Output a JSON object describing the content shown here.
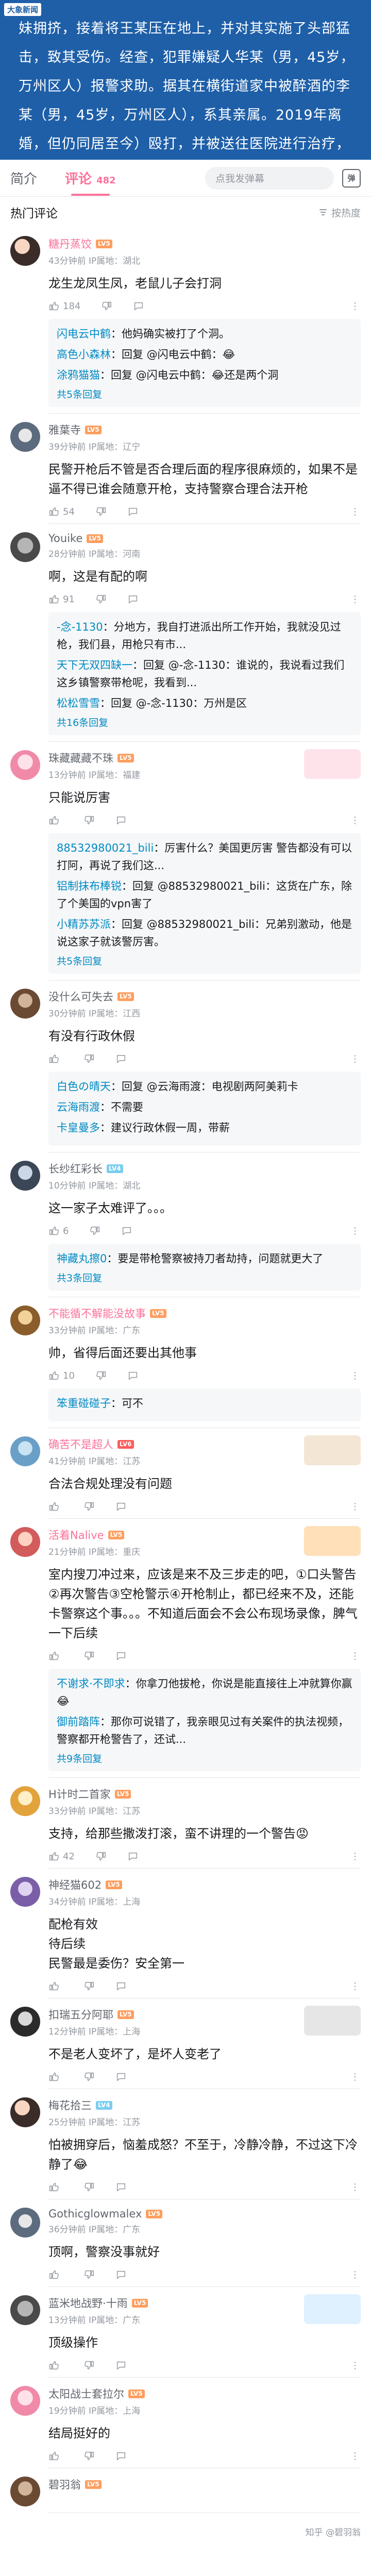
{
  "banner": {
    "badge": "大象新闻",
    "text": "妹拥挤，接着将王某压在地上，并对其实施了头部猛击，致其受伤。经查，犯罪嫌疑人华某（男，45岁，万州区人）报警求助。据其在横街道家中被醉酒的李某（男，45岁，万州区人），系其亲属。2019年离婚，但仍同居至今）殴打，并被送往医院进行治疗，经医院诊断为轻微伤。民警迅速出警，当事人将其带至派出所接受调查。调解中李某被警方依法行政拘留处罚。"
  },
  "tabs": {
    "intro": "简介",
    "comments": "评论",
    "comment_count": "482",
    "danmu_placeholder": "点我发弹幕",
    "danmu_icon": "弹"
  },
  "section": {
    "title": "热门评论",
    "sort_label": "按热度"
  },
  "comments": [
    {
      "name": "糖丹蒸饺",
      "level": "LV5",
      "time": "43分钟前",
      "location": "IP属地：湖北",
      "text": "龙生龙凤生凤，老鼠儿子会打洞",
      "likes": "184",
      "replies": [
        {
          "name": "闪电云中鹤",
          "text": "：他妈确实被打了个洞。"
        },
        {
          "name": "高色小森林",
          "text": "：回复 @闪电云中鹤：😂"
        },
        {
          "name": "涂鸦猫猫",
          "text": "：回复 @闪电云中鹤：😂还是两个洞"
        }
      ],
      "reply_total": "共5条回复"
    },
    {
      "name": "雅葉寺",
      "level": "LV5",
      "time": "39分钟前",
      "location": "IP属地：辽宁",
      "text": "民警开枪后不管是否合理后面的程序很麻烦的，如果不是逼不得已谁会随意开枪，支持警察合理合法开枪",
      "likes": "54",
      "replies": [],
      "reply_total": ""
    },
    {
      "name": "Youike",
      "level": "LV5",
      "time": "28分钟前",
      "location": "IP属地：河南",
      "text": "啊，这是有配的啊",
      "likes": "91",
      "replies": [
        {
          "name": "-念-1130",
          "text": "：分地方，我自打进派出所工作开始，我就没见过枪，我们县，用枪只有市..."
        },
        {
          "name": "天下无双四缺一",
          "text": "：回复 @-念-1130：谁说的，我说看过我们这乡镇警察带枪呢，我看到..."
        },
        {
          "name": "松松雪雪",
          "text": "：回复 @-念-1130：万州是区"
        }
      ],
      "reply_total": "共16条回复"
    },
    {
      "name": "珠藏藏藏不珠",
      "level": "LV5",
      "time": "13分钟前",
      "location": "IP属地：福建",
      "text": "只能说厉害",
      "likes": "",
      "replies": [
        {
          "name": "88532980021_bili",
          "text": "：厉害什么？美国更厉害 警告都没有可以打阿，再说了我们这..."
        },
        {
          "name": "铝制抹布棒锐",
          "text": "：回复 @88532980021_bili：这货在广东，除了个美国的vpn害了"
        },
        {
          "name": "小精苏苏派",
          "text": "：回复 @88532980021_bili：兄弟别激动，他是说这家子就该警厉害。"
        }
      ],
      "reply_total": "共5条回复"
    },
    {
      "name": "没什么可失去",
      "level": "LV5",
      "time": "30分钟前",
      "location": "IP属地：江西",
      "text": "有没有行政休假",
      "likes": "",
      "replies": [
        {
          "name": "白色の晴天",
          "text": "：回复 @云海雨渡：电视剧两阿美莉卡"
        },
        {
          "name": "云海雨渡",
          "text": "：不需要"
        },
        {
          "name": "卡皇曼多",
          "text": "：建议行政休假一周，带薪"
        }
      ],
      "reply_total": ""
    },
    {
      "name": "长纱红彩长",
      "level": "LV4",
      "time": "10分钟前",
      "location": "IP属地：湖北",
      "text": "这一家子太难评了。。。",
      "likes": "6",
      "replies": [
        {
          "name": "神藏丸擦0",
          "text": "：要是带枪警察被持刀者劫持，问题就更大了"
        }
      ],
      "reply_total": "共3条回复"
    },
    {
      "name": "不能循不解能没故事",
      "level": "LV5",
      "time": "33分钟前",
      "location": "IP属地：广东",
      "text": "帅，省得后面还要出其他事",
      "likes": "10",
      "replies": [
        {
          "name": "笨重碰碰子",
          "text": "：可不"
        }
      ],
      "reply_total": ""
    },
    {
      "name": "确苦不是超人",
      "level": "LV6",
      "time": "41分钟前",
      "location": "IP属地：江苏",
      "text": "合法合规处理没有问题",
      "likes": "",
      "replies": [],
      "reply_total": ""
    },
    {
      "name": "活着Nalive",
      "level": "LV5",
      "time": "21分钟前",
      "location": "IP属地：重庆",
      "text": "室内搜刀冲过来，应该是来不及三步走的吧，①口头警告②再次警告③空枪警示④开枪制止，都已经来不及，还能卡警察这个事。。。不知道后面会不会公布现场录像，脾气一下后续",
      "likes": "",
      "replies": [
        {
          "name": "不谢求·不即求",
          "text": "：你拿刀他拔枪，你说是能直接往上冲就算你赢😂"
        },
        {
          "name": "御前踏阵",
          "text": "：那你可说错了，我亲眼见过有关案件的执法视频，警察都开枪警告了，还试..."
        }
      ],
      "reply_total": "共9条回复"
    },
    {
      "name": "H计时二首家",
      "level": "LV5",
      "time": "33分钟前",
      "location": "IP属地：江苏",
      "text": "支持，给那些撒泼打滚，蛮不讲理的一个警告😡",
      "likes": "42",
      "replies": [],
      "reply_total": ""
    },
    {
      "name": "神经猫602",
      "level": "LV5",
      "time": "34分钟前",
      "location": "IP属地：上海",
      "text": "配枪有效\n待后续\n民警最是委伤？安全第一",
      "likes": "",
      "replies": [],
      "reply_total": ""
    },
    {
      "name": "扣瑞五分阿耶",
      "level": "LV5",
      "time": "12分钟前",
      "location": "IP属地：上海",
      "text": "不是老人变坏了，是坏人变老了",
      "likes": "",
      "replies": [],
      "reply_total": ""
    },
    {
      "name": "梅花拾三",
      "level": "LV4",
      "time": "25分钟前",
      "location": "IP属地：江苏",
      "text": "怕被拥穿后，恼羞成怒？不至于，冷静冷静，不过这下冷静了😂",
      "likes": "",
      "replies": [],
      "reply_total": ""
    },
    {
      "name": "Gothicglowmalex",
      "level": "LV5",
      "time": "36分钟前",
      "location": "IP属地：广东",
      "text": "顶啊，警察没事就好",
      "likes": "",
      "replies": [],
      "reply_total": ""
    },
    {
      "name": "蓝米地战野·十雨",
      "level": "LV5",
      "time": "13分钟前",
      "location": "IP属地：广东",
      "text": "顶级操作",
      "likes": "",
      "replies": [],
      "reply_total": ""
    },
    {
      "name": "太阳战士套拉尔",
      "level": "LV5",
      "time": "19分钟前",
      "location": "IP属地：上海",
      "text": "结局挺好的",
      "likes": "",
      "replies": [],
      "reply_total": ""
    },
    {
      "name": "碧羽翁",
      "level": "LV5",
      "time": "",
      "location": "",
      "text": "",
      "likes": "",
      "replies": [],
      "reply_total": ""
    }
  ],
  "footer": {
    "watermark": "知乎 @碧羽翁"
  },
  "icons": {
    "like": "thumbs-up-icon",
    "dislike": "thumbs-down-icon",
    "reply": "chat-bubble-icon",
    "more": "more-dots-icon",
    "sort": "sort-icon"
  },
  "colors": {
    "accent": "#fb7299",
    "link": "#008ac5",
    "banner": "#1e5fa8"
  }
}
